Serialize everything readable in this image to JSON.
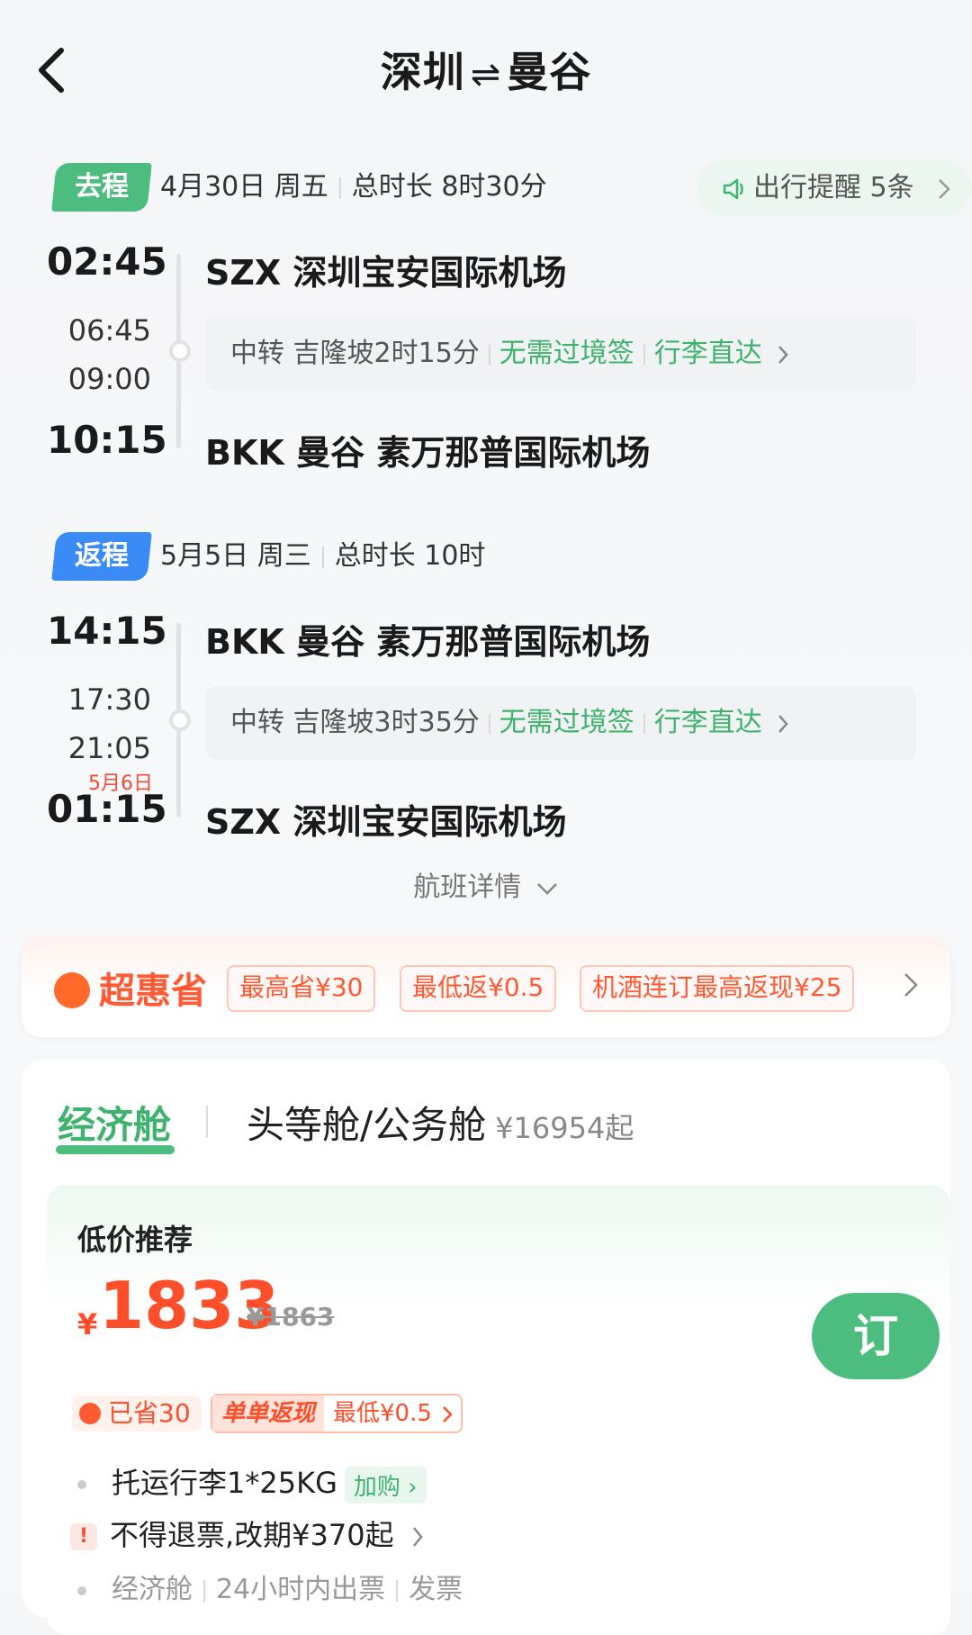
{
  "header": {
    "title_from": "深圳",
    "title_to": "曼谷"
  },
  "outbound": {
    "tag": "去程",
    "date": "4月30日 周五",
    "duration": "总时长 8时30分",
    "remind": "出行提醒 5条",
    "depart_time": "02:45",
    "depart_airport": "SZX 深圳宝安国际机场",
    "transfer_arrive": "06:45",
    "transfer_leave": "09:00",
    "transfer_text": "中转 吉隆坡2时15分",
    "visa": "无需过境签",
    "luggage": "行李直达",
    "arrive_time": "10:15",
    "arrive_airport": "BKK 曼谷 素万那普国际机场"
  },
  "return": {
    "tag": "返程",
    "date": "5月5日 周三",
    "duration": "总时长 10时",
    "depart_time": "14:15",
    "depart_airport": "BKK 曼谷 素万那普国际机场",
    "transfer_arrive": "17:30",
    "transfer_leave": "21:05",
    "next_day": "5月6日",
    "transfer_text": "中转 吉隆坡3时35分",
    "visa": "无需过境签",
    "luggage": "行李直达",
    "arrive_time": "01:15",
    "arrive_airport": "SZX 深圳宝安国际机场"
  },
  "flight_detail": "航班详情",
  "promo": {
    "title": "超惠省",
    "chips": [
      "最高省¥30",
      "最低返¥0.5",
      "机酒连订最高返现¥25"
    ]
  },
  "cabin": {
    "tab_economy": "经济舱",
    "tab_first": "头等舱/公务舱",
    "tab_first_price": "¥16954起",
    "recommend_title": "低价推荐",
    "currency": "¥",
    "price": "1833",
    "old_price": "¥1863",
    "book": "订",
    "saved": "已省30",
    "cashback_a": "单单返现",
    "cashback_b": "最低¥0.5",
    "baggage": "托运行李1*25KG",
    "addbuy": "加购",
    "refund": "不得退票,改期¥370起",
    "info_1": "经济舱",
    "info_2": "24小时内出票",
    "info_3": "发票"
  },
  "colors": {
    "green": "#4cbd7f",
    "blue": "#3a8bf5",
    "orange": "#ff4e2a"
  }
}
